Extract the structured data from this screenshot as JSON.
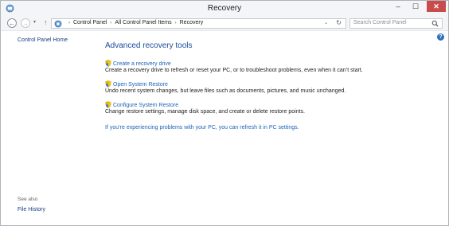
{
  "window": {
    "title": "Recovery"
  },
  "caption": {
    "minimize": "–",
    "maximize": "☐",
    "close": "✕"
  },
  "nav": {
    "back": "←",
    "forward": "→",
    "history": "▾",
    "up": "↑",
    "breadcrumbs": [
      "Control Panel",
      "All Control Panel Items",
      "Recovery"
    ],
    "separator": "›",
    "address_dropdown": "⌄",
    "refresh": "↻"
  },
  "search": {
    "placeholder": "Search Control Panel"
  },
  "help": {
    "glyph": "?"
  },
  "sidebar": {
    "home_link": "Control Panel Home",
    "see_also_heading": "See also",
    "see_also_links": [
      "File History"
    ]
  },
  "main": {
    "heading": "Advanced recovery tools",
    "tasks": [
      {
        "label": "Create a recovery drive",
        "description": "Create a recovery drive to refresh or reset your PC, or to troubleshoot problems, even when it can’t start."
      },
      {
        "label": "Open System Restore",
        "description": "Undo recent system changes, but leave files such as documents, pictures, and music unchanged."
      },
      {
        "label": "Configure System Restore",
        "description": "Change restore settings, manage disk space, and create or delete restore points."
      }
    ],
    "refresh_link": "If you’re experiencing problems with your PC, you can refresh it in PC settings."
  },
  "colors": {
    "link": "#1c63b7",
    "heading": "#1b4a9a",
    "close_button": "#c94c4c"
  },
  "icons": [
    "control-panel-icon",
    "shield-icon",
    "search-icon",
    "help-icon"
  ]
}
